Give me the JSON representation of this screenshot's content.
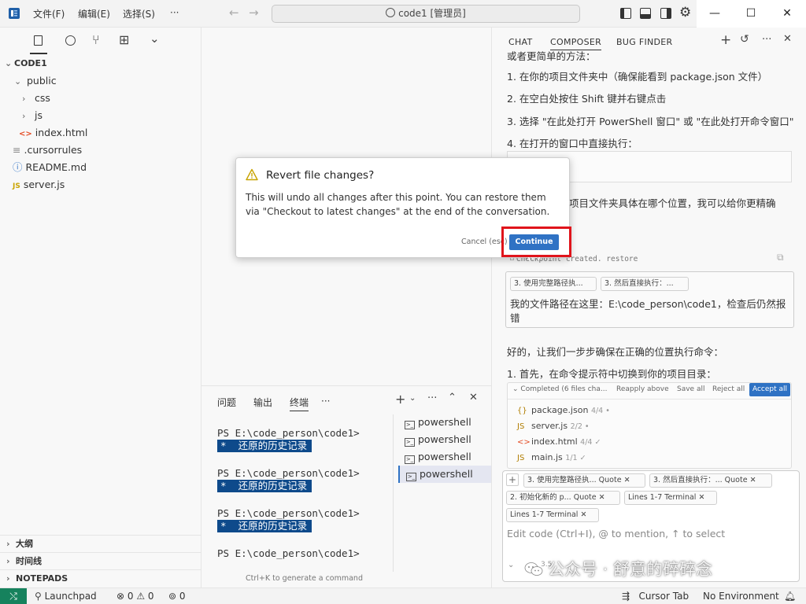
{
  "titlebar": {
    "menus": [
      "文件(F)",
      "编辑(E)",
      "选择(S)",
      "···"
    ],
    "search_text": "code1 [管理员]",
    "win_minimize": "—",
    "win_maximize": "☐",
    "win_close": "✕"
  },
  "sidebar": {
    "project": "CODE1",
    "tree": [
      {
        "label": "public",
        "icon": "chevron-down"
      },
      {
        "label": "css",
        "icon": "chevron-right"
      },
      {
        "label": "js",
        "icon": "chevron-right"
      },
      {
        "label": "index.html",
        "icon": "html-file"
      },
      {
        "label": ".cursorrules",
        "icon": "lines-file"
      },
      {
        "label": "README.md",
        "icon": "info-file"
      },
      {
        "label": "server.js",
        "icon": "js-file"
      }
    ],
    "sections": [
      "大纲",
      "时间线",
      "NOTEPADS"
    ]
  },
  "panel": {
    "tabs": [
      "问题",
      "输出",
      "终端",
      "···"
    ],
    "prompt": "PS E:\\code_person\\code1>",
    "history_mark": "*",
    "history_text": "还原的历史记录",
    "terminals": [
      "powershell",
      "powershell",
      "powershell",
      "powershell"
    ],
    "hint": "Ctrl+K to generate a command"
  },
  "composer": {
    "tabs": [
      "CHAT",
      "COMPOSER",
      "BUG FINDER"
    ],
    "lines_top": [
      "或者更简单的方法：",
      "1. 在你的项目文件夹中（确保能看到 package.json 文件）",
      "2. 在空白处按住 Shift 键并右键点击",
      "3. 选择 \"在此处打开 PowerShell 窗口\" 或 \"在此处打开命令窗口\"",
      "4. 在打开的窗口中直接执行："
    ],
    "partial_right": "项目文件夹具体在哪个位置，我可以给你更精确",
    "partial_right_tail": "确",
    "checkpoint": "Checkpoint created. restore",
    "quote_chips_top": [
      "3. 使用完整路径执...",
      "3. 然后直接执行：..."
    ],
    "user_message_1": "我的文件路径在这里：E:\\code_person\\code1，检查后仍然报",
    "user_message_2": "错",
    "reply_1": "好的，让我们一步步确保在正确的位置执行命令：",
    "reply_2": "1. 首先，在命令提示符中切换到你的项目目录：",
    "changes": {
      "summary": "Completed (6 files cha...",
      "reapply": "Reapply above",
      "save_all": "Save all",
      "reject_all": "Reject all",
      "accept_all": "Accept all",
      "files": [
        {
          "icon": "{}",
          "name": "package.json",
          "count": "4/4 •"
        },
        {
          "icon": "JS",
          "name": "server.js",
          "count": "2/2 •"
        },
        {
          "icon": "<>",
          "name": "index.html",
          "count": "4/4 ✓"
        },
        {
          "icon": "JS",
          "name": "main.js",
          "count": "1/1 ✓"
        }
      ]
    },
    "context_chips": [
      "3. 使用完整路径执... Quote ✕",
      "3. 然后直接执行：... Quote ✕",
      "2. 初始化新的 p... Quote ✕",
      "Lines 1-7 Terminal ✕",
      "Lines 1-7 Terminal ✕"
    ],
    "input_placeholder": "Edit code (Ctrl+I), @ to mention, ↑ to select",
    "model_hint": "3.5"
  },
  "statusbar": {
    "launchpad": "Launchpad",
    "errors": "⊗ 0 ⚠ 0",
    "ports": "0",
    "cursor_tab": "Cursor Tab",
    "environment": "No Environment"
  },
  "dialog": {
    "title": "Revert file changes?",
    "body": "This will undo all changes after this point. You can restore them via \"Checkout to latest changes\" at the end of the conversation.",
    "cancel": "Cancel (esc)",
    "continue": "Continue (⏎)"
  },
  "watermark": "公众号 · 舒意的碎碎念",
  "colors": {
    "accent": "#2f72c4",
    "highlight_box": "#e0141b",
    "terminal_highlight": "#0e4a8b",
    "statusbar_remote": "#16825d"
  }
}
